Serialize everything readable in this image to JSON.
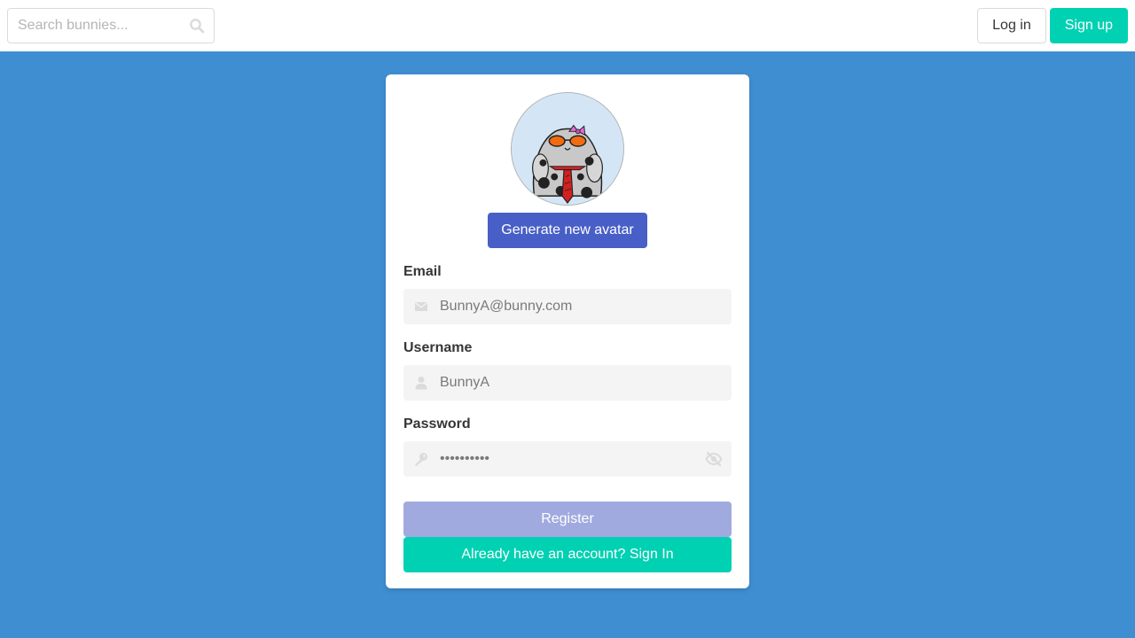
{
  "navbar": {
    "search_placeholder": "Search bunnies...",
    "login_label": "Log in",
    "signup_label": "Sign up"
  },
  "form": {
    "generate_label": "Generate new avatar",
    "email": {
      "label": "Email",
      "value": "BunnyA@bunny.com",
      "icon": "envelope-icon"
    },
    "username": {
      "label": "Username",
      "value": "BunnyA",
      "icon": "user-icon"
    },
    "password": {
      "label": "Password",
      "value": "••••••••••",
      "icon": "key-icon",
      "toggle_icon": "eye-slash-icon"
    },
    "register_label": "Register",
    "signin_label": "Already have an account? Sign In"
  },
  "colors": {
    "background": "#3f8ed2",
    "primary": "#485fc7",
    "primary_disabled": "#a1aadf",
    "accent": "#00d1b2"
  }
}
